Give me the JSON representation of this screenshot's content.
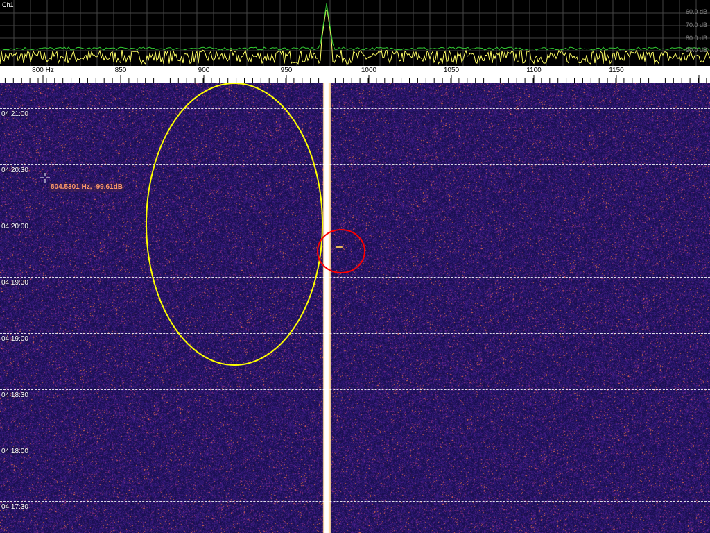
{
  "app": {
    "channel": "Ch1"
  },
  "spectrum": {
    "db_labels": [
      "60.0 dB",
      "70.0 dB",
      "80.0 dB",
      "90.0 dB"
    ]
  },
  "frequency_axis": {
    "labels": [
      "800  Hz",
      "850",
      "900",
      "950",
      "1000",
      "1050",
      "1100",
      "1150"
    ]
  },
  "waterfall": {
    "time_labels": [
      "04:21:00",
      "04:20:30",
      "04:20:00",
      "04:19:30",
      "04:19:00",
      "04:18:30",
      "04:18:00",
      "04:17:30"
    ]
  },
  "cursor": {
    "readout": "804.5301 Hz, -99.61dB"
  },
  "colors": {
    "background": "#2a1a6e",
    "carrier": "#ffffff",
    "annotation_ellipse": "#ffff00",
    "annotation_circle": "#ff0000",
    "spectrum_trace_peak": "#33cc33",
    "spectrum_trace_avg": "#ffff66",
    "readout_text": "#ff9a6a"
  }
}
